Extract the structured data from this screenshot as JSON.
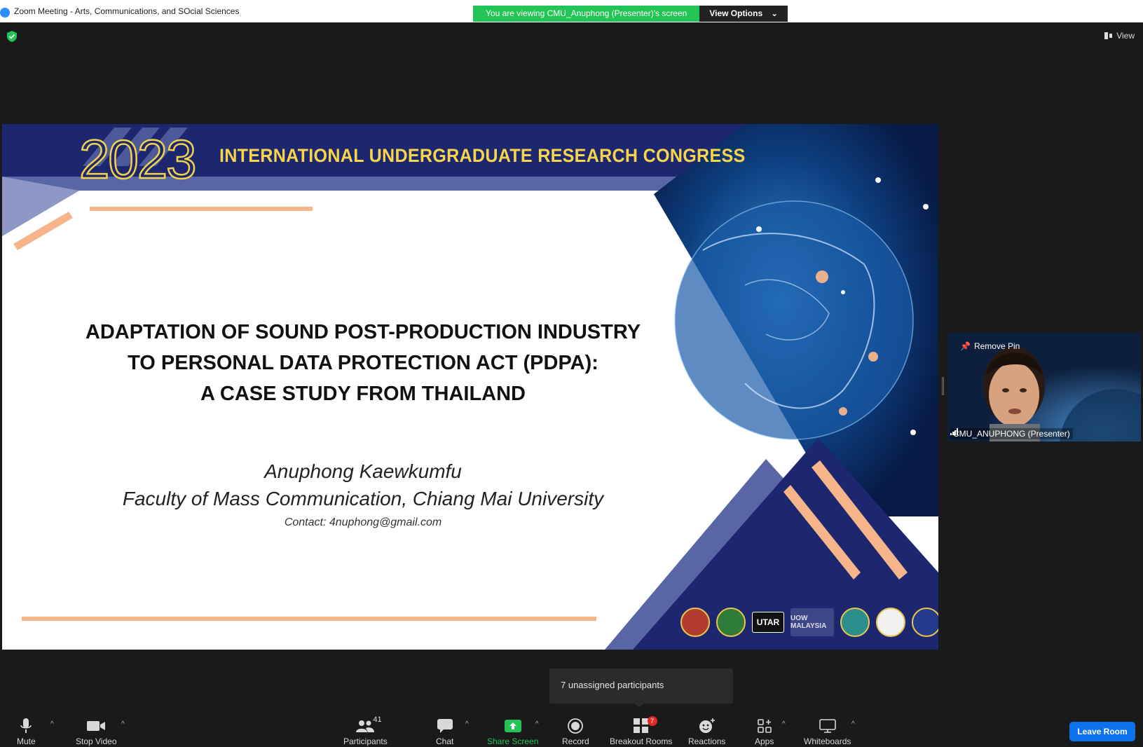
{
  "window": {
    "title": "Zoom Meeting - Arts, Communications, and SOcial Sciences"
  },
  "share_banner": {
    "message": "You are viewing CMU_Anuphong (Presenter)'s screen",
    "options_label": "View Options"
  },
  "top_right": {
    "view_label": "View"
  },
  "slide": {
    "year": "2023",
    "congress": "INTERNATIONAL UNDERGRADUATE RESEARCH CONGRESS",
    "title_lines": [
      "ADAPTATION OF SOUND POST-PRODUCTION INDUSTRY",
      "TO PERSONAL DATA PROTECTION ACT (PDPA):",
      "A CASE STUDY FROM THAILAND"
    ],
    "author": "Anuphong Kaewkumfu",
    "faculty": "Faculty of Mass Communication, Chiang Mai University",
    "contact": "Contact: 4nuphong@gmail.com",
    "logos": [
      "UTAR",
      "UOW MALAYSIA"
    ]
  },
  "video_tile": {
    "remove_pin_label": "Remove Pin",
    "participant_name": "CMU_ANUPHONG (Presenter)"
  },
  "tooltip": {
    "text": "7 unassigned participants"
  },
  "toolbar": {
    "mute": "Mute",
    "stop_video": "Stop Video",
    "participants": "Participants",
    "participants_count": "41",
    "chat": "Chat",
    "share_screen": "Share Screen",
    "record": "Record",
    "breakout_rooms": "Breakout Rooms",
    "breakout_badge": "7",
    "reactions": "Reactions",
    "apps": "Apps",
    "whiteboards": "Whiteboards",
    "leave_room": "Leave Room"
  },
  "colors": {
    "zoom_blue": "#0e72ed",
    "green": "#23c456",
    "slide_navy": "#1d2770",
    "slide_gold": "#f1d24a",
    "slide_peach": "#f5b48a"
  }
}
